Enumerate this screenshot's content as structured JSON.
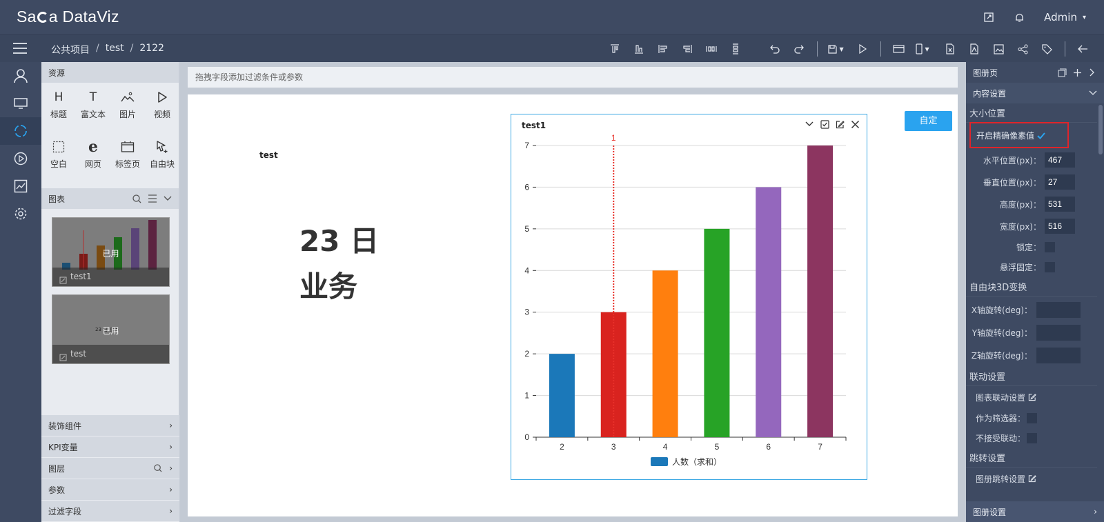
{
  "header": {
    "logo": "DataViz",
    "logo_prefix": "Sa",
    "logo_suffix": "a",
    "user": "Admin"
  },
  "breadcrumb": [
    "公共项目",
    "test",
    "2122"
  ],
  "toolbar_icons": [
    "align-top-icon",
    "align-bottom-icon",
    "align-left-icon",
    "align-right-icon",
    "distribute-h-icon",
    "distribute-v-icon",
    "undo-icon",
    "redo-icon",
    "save-icon",
    "play-icon",
    "card-icon",
    "mobile-icon",
    "excel-icon",
    "pdf-icon",
    "image-icon",
    "share-icon",
    "tag-icon",
    "back-icon"
  ],
  "resources": {
    "title": "资源",
    "items": [
      {
        "label": "标题",
        "icon": "heading-icon"
      },
      {
        "label": "富文本",
        "icon": "richtext-icon"
      },
      {
        "label": "图片",
        "icon": "picture-icon"
      },
      {
        "label": "视频",
        "icon": "video-icon"
      },
      {
        "label": "空白",
        "icon": "blank-icon"
      },
      {
        "label": "网页",
        "icon": "web-icon"
      },
      {
        "label": "标签页",
        "icon": "tabs-icon"
      },
      {
        "label": "自由块",
        "icon": "freeblock-icon"
      }
    ]
  },
  "charts_panel": {
    "title": "图表",
    "thumbs": [
      {
        "used": "已用",
        "caption": "test1"
      },
      {
        "used": "已用",
        "caption": "test"
      }
    ],
    "thumb2_overlay": "23 日 业务"
  },
  "accordion": [
    "装饰组件",
    "KPI变量",
    "图层",
    "参数",
    "过滤字段"
  ],
  "filter_placeholder": "拖拽字段添加过滤条件或参数",
  "canvas": {
    "text_label": "test",
    "big_title_line1": "23 日",
    "big_title_line2": "业务",
    "confirm": "自定"
  },
  "chart_data": {
    "type": "bar",
    "title": "test1",
    "categories": [
      "2",
      "3",
      "4",
      "5",
      "6",
      "7"
    ],
    "values": [
      2,
      3,
      4,
      5,
      6,
      7
    ],
    "colors": [
      "#1b78b9",
      "#d9231f",
      "#ff7f0e",
      "#27a326",
      "#9467bd",
      "#8c3560"
    ],
    "ylim": [
      0,
      7
    ],
    "yticks": [
      0,
      1,
      2,
      3,
      4,
      5,
      6,
      7
    ],
    "legend": "人数（求和）",
    "legend_color": "#1b78b9",
    "legend_position": "bottom",
    "reference_line": {
      "category": "3",
      "label": "1",
      "color": "#e8312a"
    },
    "grid": true
  },
  "right_panel": {
    "title": "图册页",
    "content_settings": "内容设置",
    "size_position": "大小位置",
    "precise_pixel": "开启精确像素值",
    "fields": [
      {
        "label": "水平位置(px)：",
        "value": "467"
      },
      {
        "label": "垂直位置(px)：",
        "value": "27"
      },
      {
        "label": "高度(px)：",
        "value": "531"
      },
      {
        "label": "宽度(px)：",
        "value": "516"
      }
    ],
    "lock": "锁定：",
    "float_fixed": "悬浮固定：",
    "transform_3d": "自由块3D变换",
    "rotations": [
      "X轴旋转(deg)：",
      "Y轴旋转(deg)：",
      "Z轴旋转(deg)："
    ],
    "link_settings": "联动设置",
    "chart_link": "图表联动设置",
    "as_filter": "作为筛选器：",
    "no_link": "不接受联动：",
    "jump_settings": "跳转设置",
    "album_jump": "图册跳转设置",
    "footer": "图册设置"
  }
}
